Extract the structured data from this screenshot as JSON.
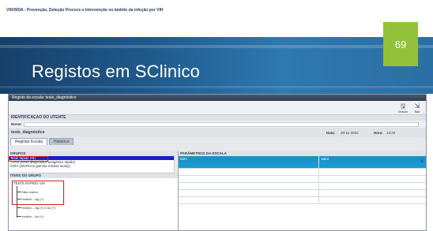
{
  "header": {
    "text": "VIH/SIDA - Prevenção, Deteção Precoce e Intervenção no âmbito da infeção por VIH"
  },
  "slide": {
    "title": "Registos em SClinico",
    "number": "69"
  },
  "window": {
    "title": "Registo da escala: teste_diagnóstico"
  },
  "toolbar": {
    "save_label": "Gravar",
    "exit_label": "Sair"
  },
  "patient": {
    "section_title": "IDENTIFICAÇÃO DO UTENTE",
    "name_label": "Nome:",
    "name_value": ""
  },
  "scale": {
    "name": "teste_diagnóstico",
    "date_label": "Data:",
    "date_value": "28-11-2022",
    "time_label": "Hora:",
    "time_value": "13:22"
  },
  "tabs": [
    {
      "label": "Registar Escala"
    },
    {
      "label": "Histórico"
    }
  ],
  "groups": {
    "header": "GRUPOS",
    "items": [
      {
        "label": "Teste rápido VIH"
      },
      {
        "label": "TDAR (teste diagnóstico antigénico rápido)"
      },
      {
        "label": "IGRA (interferon gamma release assay)"
      }
    ]
  },
  "group_items": {
    "header": "ITENS DO GRUPO",
    "root": "TESTE RÁPIDO VIH",
    "nodes": [
      {
        "label": "Não reativo"
      },
      {
        "label": "reativo – Ag (+)"
      },
      {
        "label": "reativo – Ag (+) e Ac (+)"
      },
      {
        "label": "reativo – Ac (+)"
      }
    ]
  },
  "parameters": {
    "header": "PARÂMETROS DA ESCALA",
    "col_name": "Item",
    "col_value": "Valor"
  },
  "colors": {
    "banner": "#1f5a8c",
    "slide_number_bg": "#93c13a",
    "selection": "#1a1fc9",
    "highlight_box": "#e01e1e"
  },
  "icons": {
    "save": "disk-icon",
    "exit": "exit-icon",
    "close": "close-icon"
  }
}
